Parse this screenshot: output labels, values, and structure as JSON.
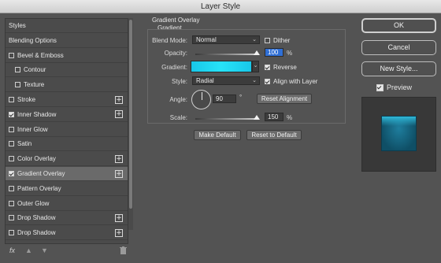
{
  "window": {
    "title": "Layer Style"
  },
  "styles_panel": {
    "items": [
      {
        "label": "Styles",
        "checkbox": false,
        "checked": false,
        "indent": false,
        "plus": false,
        "selected": false
      },
      {
        "label": "Blending Options",
        "checkbox": false,
        "checked": false,
        "indent": false,
        "plus": false,
        "selected": false
      },
      {
        "label": "Bevel & Emboss",
        "checkbox": true,
        "checked": false,
        "indent": false,
        "plus": false,
        "selected": false
      },
      {
        "label": "Contour",
        "checkbox": true,
        "checked": false,
        "indent": true,
        "plus": false,
        "selected": false
      },
      {
        "label": "Texture",
        "checkbox": true,
        "checked": false,
        "indent": true,
        "plus": false,
        "selected": false
      },
      {
        "label": "Stroke",
        "checkbox": true,
        "checked": false,
        "indent": false,
        "plus": true,
        "selected": false
      },
      {
        "label": "Inner Shadow",
        "checkbox": true,
        "checked": true,
        "indent": false,
        "plus": true,
        "selected": false
      },
      {
        "label": "Inner Glow",
        "checkbox": true,
        "checked": false,
        "indent": false,
        "plus": false,
        "selected": false
      },
      {
        "label": "Satin",
        "checkbox": true,
        "checked": false,
        "indent": false,
        "plus": false,
        "selected": false
      },
      {
        "label": "Color Overlay",
        "checkbox": true,
        "checked": false,
        "indent": false,
        "plus": true,
        "selected": false
      },
      {
        "label": "Gradient Overlay",
        "checkbox": true,
        "checked": true,
        "indent": false,
        "plus": true,
        "selected": true
      },
      {
        "label": "Pattern Overlay",
        "checkbox": true,
        "checked": false,
        "indent": false,
        "plus": false,
        "selected": false
      },
      {
        "label": "Outer Glow",
        "checkbox": true,
        "checked": false,
        "indent": false,
        "plus": false,
        "selected": false
      },
      {
        "label": "Drop Shadow",
        "checkbox": true,
        "checked": false,
        "indent": false,
        "plus": true,
        "selected": false
      },
      {
        "label": "Drop Shadow",
        "checkbox": true,
        "checked": false,
        "indent": false,
        "plus": true,
        "selected": false
      }
    ],
    "bottom_bar": {
      "fx_label": "fx",
      "up_icon": "arrow-up-icon",
      "down_icon": "arrow-down-icon",
      "trash_icon": "trash-icon"
    }
  },
  "gradient_overlay": {
    "section_title": "Gradient Overlay",
    "group_title": "Gradient",
    "blend_mode_label": "Blend Mode:",
    "blend_mode_value": "Normal",
    "dither_label": "Dither",
    "dither_checked": false,
    "opacity_label": "Opacity:",
    "opacity_value": "100",
    "opacity_unit": "%",
    "opacity_level": 1.0,
    "gradient_label": "Gradient:",
    "gradient_colors": [
      "#18c7e8",
      "#27e3f8",
      "#18c7e8"
    ],
    "reverse_label": "Reverse",
    "reverse_checked": true,
    "style_label": "Style:",
    "style_value": "Radial",
    "align_label": "Align with Layer",
    "align_checked": true,
    "angle_label": "Angle:",
    "angle_value": "90",
    "angle_unit": "°",
    "reset_alignment_label": "Reset Alignment",
    "scale_label": "Scale:",
    "scale_value": "150",
    "scale_unit": "%",
    "scale_level": 1.0,
    "make_default_label": "Make Default",
    "reset_default_label": "Reset to Default"
  },
  "right_panel": {
    "ok_label": "OK",
    "cancel_label": "Cancel",
    "new_style_label": "New Style...",
    "preview_label": "Preview",
    "preview_checked": true
  }
}
